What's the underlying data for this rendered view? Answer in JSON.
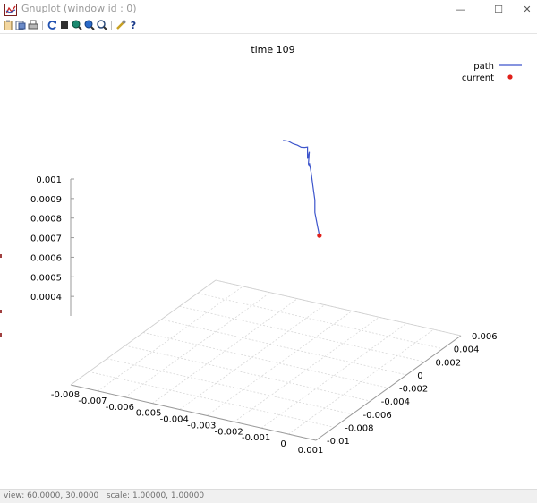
{
  "window": {
    "title": "Gnuplot (window id : 0)",
    "icon": "gnuplot-app-icon",
    "controls": {
      "minimize": "—",
      "maximize": "☐",
      "close": "✕"
    }
  },
  "toolbar": {
    "icons": [
      "copy-clipboard-icon",
      "print-icon",
      "printer-setup-icon",
      "replot-icon",
      "grid-icon",
      "zoom-previous-icon",
      "zoom-next-icon",
      "autoscale-icon",
      "options-icon",
      "help-icon"
    ],
    "help_label": "?"
  },
  "status": {
    "text": "view: 60.0000, 30.0000   scale: 1.00000, 1.00000"
  },
  "chart_data": {
    "type": "line3d",
    "title": "time 109",
    "legend": {
      "placement": "top-right",
      "entries": [
        {
          "name": "path",
          "style": "line",
          "color": "#3d55cc"
        },
        {
          "name": "current",
          "style": "point",
          "color": "#e0201a"
        }
      ]
    },
    "view": {
      "rot_x": 60,
      "rot_z": 30,
      "scale": 1.0
    },
    "axes": {
      "x": {
        "range": [
          -0.008,
          0.001
        ],
        "ticks": [
          "-0.008",
          "-0.007",
          "-0.006",
          "-0.005",
          "-0.004",
          "-0.003",
          "-0.002",
          "-0.001",
          "0",
          "0.001"
        ]
      },
      "y": {
        "range": [
          -0.01,
          0.006
        ],
        "ticks": [
          "-0.01",
          "-0.008",
          "-0.006",
          "-0.004",
          "-0.002",
          "0",
          "0.002",
          "0.004",
          "0.006"
        ]
      },
      "z": {
        "range": [
          0.0003,
          0.001
        ],
        "ticks": [
          "0.0004",
          "0.0005",
          "0.0006",
          "0.0007",
          "0.0008",
          "0.0009",
          "0.001"
        ]
      }
    },
    "grid": true,
    "series": [
      {
        "name": "path",
        "color": "#3d55cc",
        "points": [
          {
            "x": -0.0047,
            "y": 0.0035,
            "z": 0.00085
          },
          {
            "x": -0.0045,
            "y": 0.0035,
            "z": 0.000852
          },
          {
            "x": -0.0043,
            "y": 0.0034,
            "z": 0.000849
          },
          {
            "x": -0.0041,
            "y": 0.0033,
            "z": 0.000851
          },
          {
            "x": -0.0039,
            "y": 0.0031,
            "z": 0.000854
          },
          {
            "x": -0.0037,
            "y": 0.0029,
            "z": 0.000866
          },
          {
            "x": -0.0035,
            "y": 0.0026,
            "z": 0.000884
          },
          {
            "x": -0.0034,
            "y": 0.0023,
            "z": 0.00087
          },
          {
            "x": -0.0033,
            "y": 0.002,
            "z": 0.00085
          },
          {
            "x": -0.0031,
            "y": 0.0016,
            "z": 0.000905
          },
          {
            "x": -0.003,
            "y": 0.0012,
            "z": 0.00086
          },
          {
            "x": -0.0028,
            "y": 0.0008,
            "z": 0.00086
          },
          {
            "x": -0.0027,
            "y": 0.0004,
            "z": 0.0009
          },
          {
            "x": -0.0025,
            "y": 0.0,
            "z": 0.00087
          },
          {
            "x": -0.0023,
            "y": -0.0004,
            "z": 0.00082
          },
          {
            "x": -0.0021,
            "y": -0.0008,
            "z": 0.00077
          },
          {
            "x": -0.002,
            "y": -0.0011,
            "z": 0.00072
          },
          {
            "x": -0.0018,
            "y": -0.0014,
            "z": 0.000665
          },
          {
            "x": -0.0017,
            "y": -0.0015,
            "z": 0.000625
          }
        ]
      },
      {
        "name": "current",
        "color": "#e0201a",
        "points": [
          {
            "x": -0.0017,
            "y": -0.0015,
            "z": 0.000625
          }
        ]
      }
    ]
  }
}
